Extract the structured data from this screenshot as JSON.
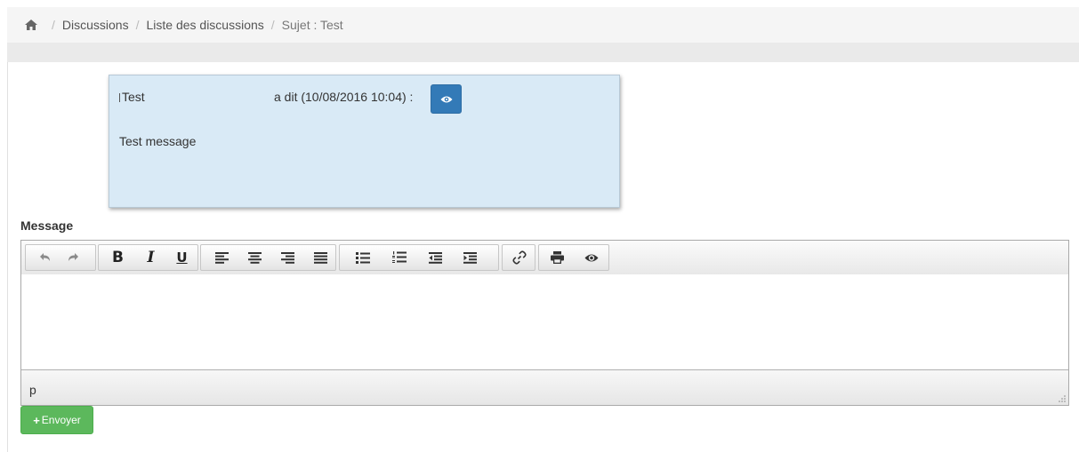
{
  "breadcrumb": {
    "home_icon": "home-icon",
    "separator": "/",
    "items": [
      {
        "label": "Discussions"
      },
      {
        "label": "Liste des discussions"
      },
      {
        "label": "Sujet : Test"
      }
    ]
  },
  "message": {
    "author": "Test",
    "said": "a dit (10/08/2016 10:04) :",
    "view_icon": "eye-icon",
    "body": "Test message"
  },
  "form": {
    "label": "Message",
    "editor": {
      "toolbar": [
        {
          "group": "history",
          "buttons": [
            "undo-icon",
            "redo-icon"
          ]
        },
        {
          "group": "format",
          "buttons": [
            "B",
            "I",
            "U"
          ]
        },
        {
          "group": "align",
          "buttons": [
            "align-left-icon",
            "align-center-icon",
            "align-right-icon",
            "align-justify-icon"
          ]
        },
        {
          "group": "lists",
          "buttons": [
            "bullet-list-icon",
            "numbered-list-icon",
            "outdent-icon",
            "indent-icon"
          ]
        },
        {
          "group": "link",
          "buttons": [
            "link-icon"
          ]
        },
        {
          "group": "misc",
          "buttons": [
            "print-icon",
            "preview-icon"
          ]
        }
      ],
      "content": "",
      "status_path": "p"
    },
    "submit_label": "Envoyer",
    "submit_icon": "plus-icon"
  },
  "colors": {
    "primary": "#337ab7",
    "success": "#5cb85c",
    "card_bg": "#d9eaf6",
    "breadcrumb_bg": "#f5f5f5"
  }
}
